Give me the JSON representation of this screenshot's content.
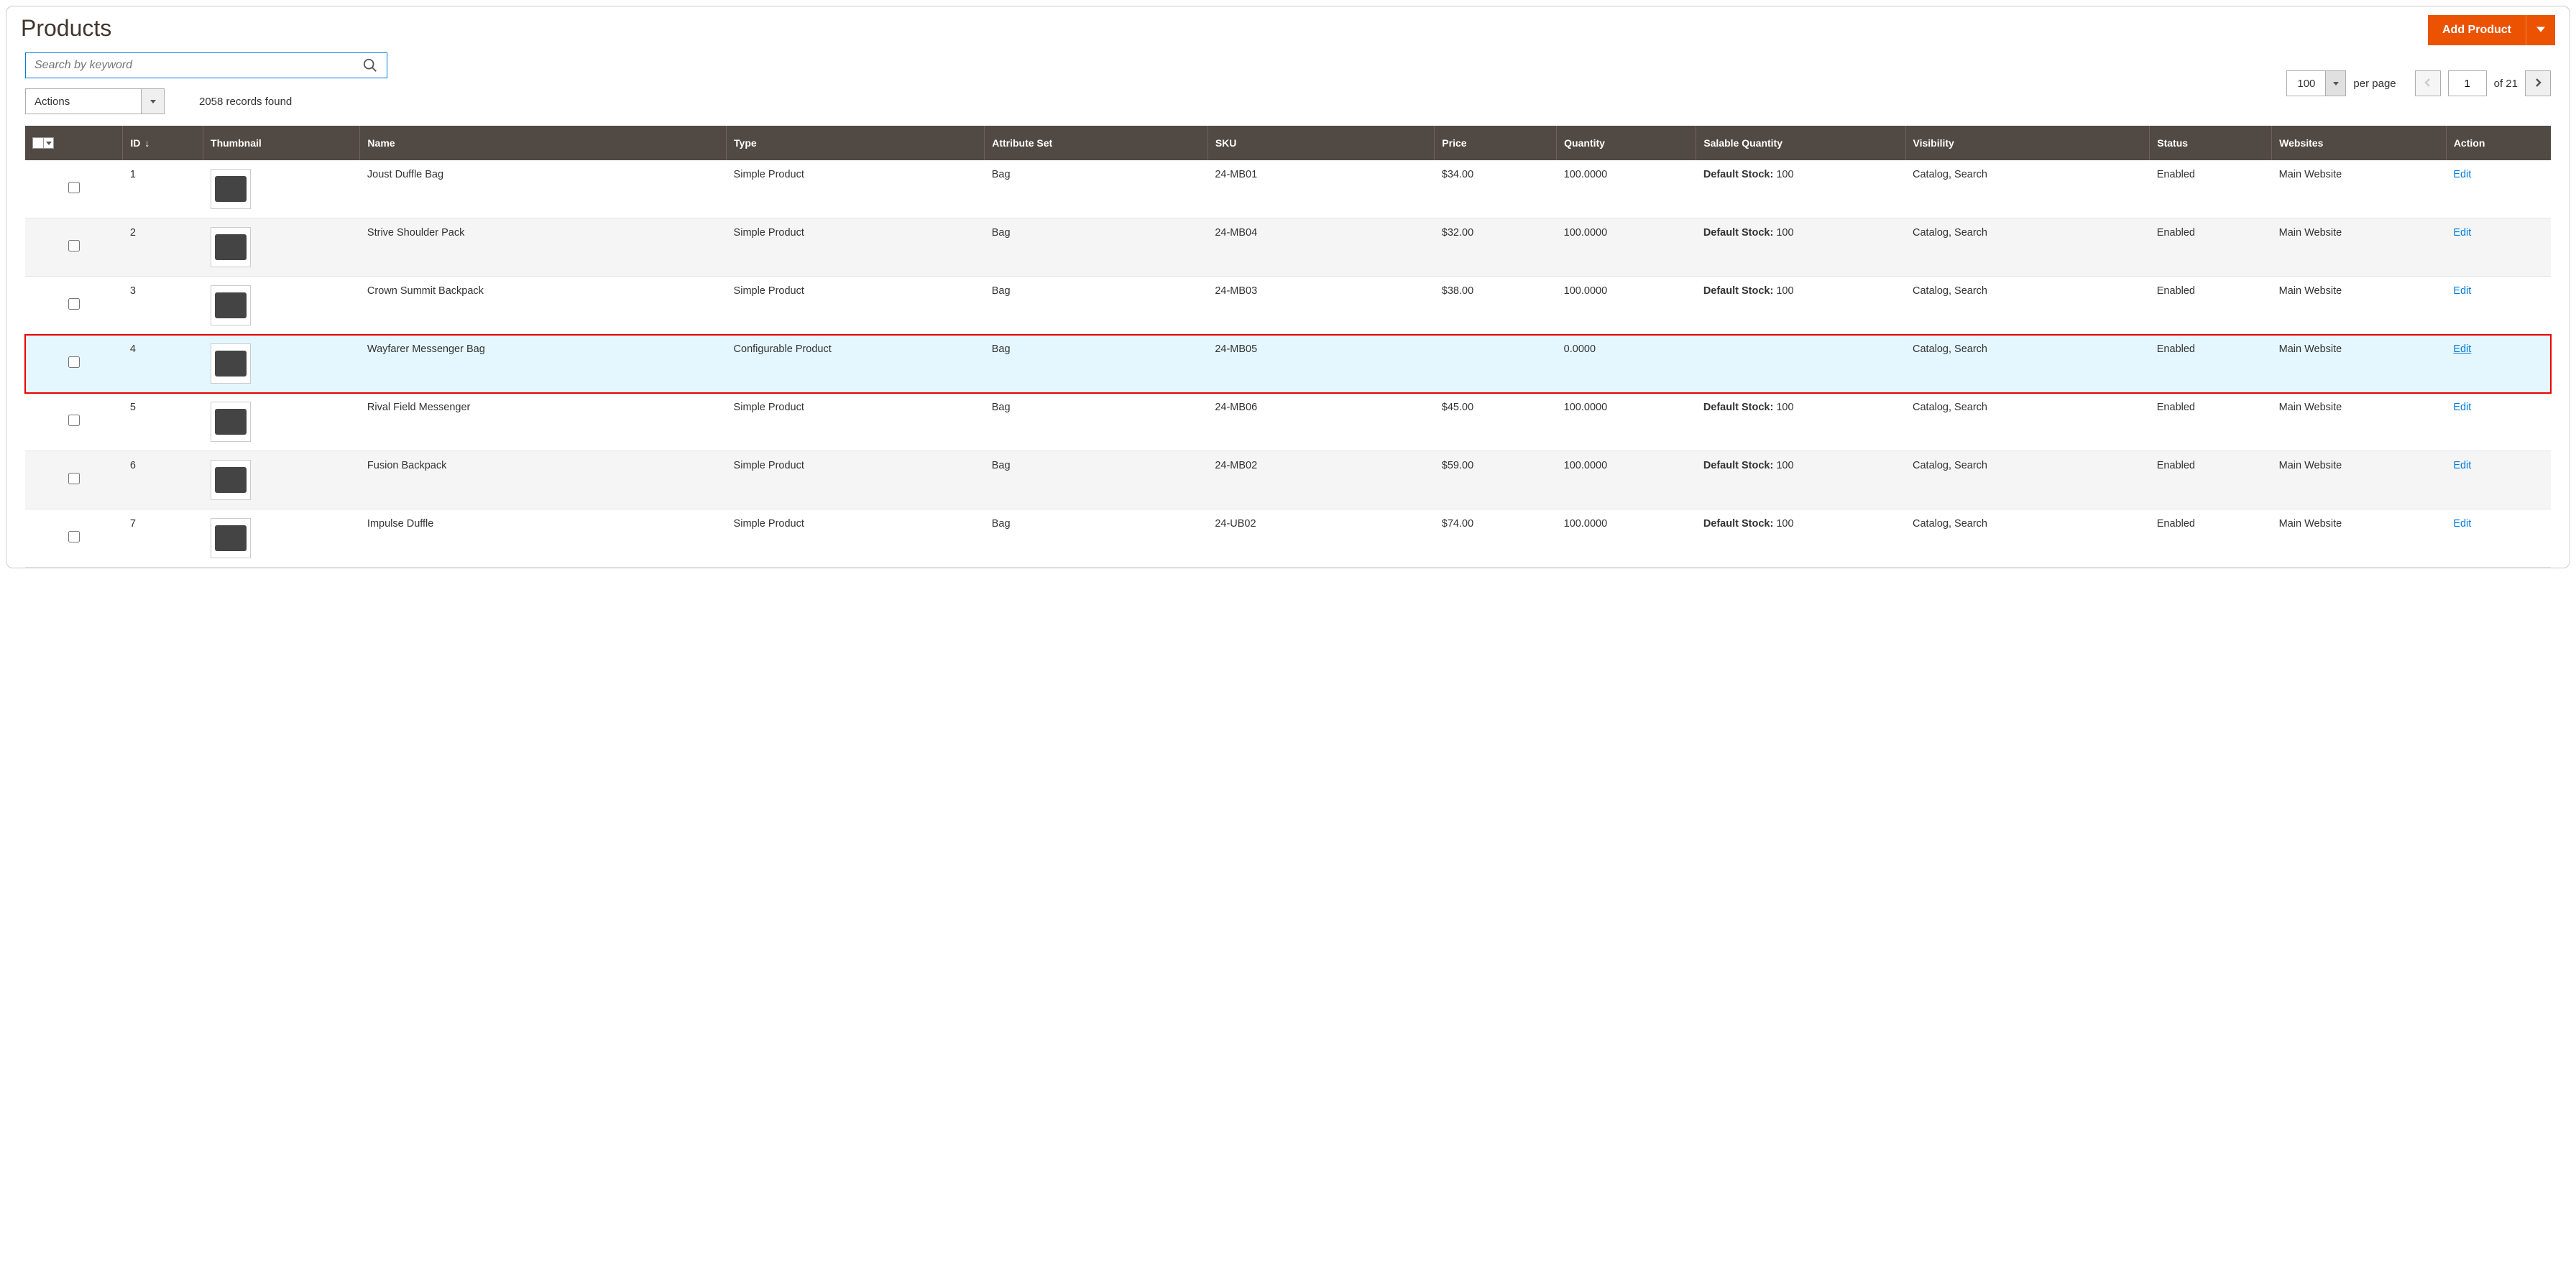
{
  "header": {
    "title": "Products",
    "add_button": "Add Product"
  },
  "toolbar": {
    "search_placeholder": "Search by keyword",
    "actions_label": "Actions",
    "records_found": "2058 records found",
    "per_page_value": "100",
    "per_page_label": "per page",
    "current_page": "1",
    "of_label": "of 21"
  },
  "grid": {
    "columns": {
      "id": "ID",
      "thumbnail": "Thumbnail",
      "name": "Name",
      "type": "Type",
      "attribute_set": "Attribute Set",
      "sku": "SKU",
      "price": "Price",
      "quantity": "Quantity",
      "salable_quantity": "Salable Quantity",
      "visibility": "Visibility",
      "status": "Status",
      "websites": "Websites",
      "action": "Action"
    },
    "rows": [
      {
        "id": "1",
        "name": "Joust Duffle Bag",
        "type": "Simple Product",
        "attr": "Bag",
        "sku": "24-MB01",
        "price": "$34.00",
        "qty": "100.0000",
        "salable_label": "Default Stock",
        "salable_value": "100",
        "visibility": "Catalog, Search",
        "status": "Enabled",
        "websites": "Main Website",
        "action": "Edit",
        "highlight": false
      },
      {
        "id": "2",
        "name": "Strive Shoulder Pack",
        "type": "Simple Product",
        "attr": "Bag",
        "sku": "24-MB04",
        "price": "$32.00",
        "qty": "100.0000",
        "salable_label": "Default Stock",
        "salable_value": "100",
        "visibility": "Catalog, Search",
        "status": "Enabled",
        "websites": "Main Website",
        "action": "Edit",
        "highlight": false
      },
      {
        "id": "3",
        "name": "Crown Summit Backpack",
        "type": "Simple Product",
        "attr": "Bag",
        "sku": "24-MB03",
        "price": "$38.00",
        "qty": "100.0000",
        "salable_label": "Default Stock",
        "salable_value": "100",
        "visibility": "Catalog, Search",
        "status": "Enabled",
        "websites": "Main Website",
        "action": "Edit",
        "highlight": false
      },
      {
        "id": "4",
        "name": "Wayfarer Messenger Bag",
        "type": "Configurable Product",
        "attr": "Bag",
        "sku": "24-MB05",
        "price": "",
        "qty": "0.0000",
        "salable_label": "",
        "salable_value": "",
        "visibility": "Catalog, Search",
        "status": "Enabled",
        "websites": "Main Website",
        "action": "Edit",
        "highlight": true
      },
      {
        "id": "5",
        "name": "Rival Field Messenger",
        "type": "Simple Product",
        "attr": "Bag",
        "sku": "24-MB06",
        "price": "$45.00",
        "qty": "100.0000",
        "salable_label": "Default Stock",
        "salable_value": "100",
        "visibility": "Catalog, Search",
        "status": "Enabled",
        "websites": "Main Website",
        "action": "Edit",
        "highlight": false
      },
      {
        "id": "6",
        "name": "Fusion Backpack",
        "type": "Simple Product",
        "attr": "Bag",
        "sku": "24-MB02",
        "price": "$59.00",
        "qty": "100.0000",
        "salable_label": "Default Stock",
        "salable_value": "100",
        "visibility": "Catalog, Search",
        "status": "Enabled",
        "websites": "Main Website",
        "action": "Edit",
        "highlight": false
      },
      {
        "id": "7",
        "name": "Impulse Duffle",
        "type": "Simple Product",
        "attr": "Bag",
        "sku": "24-UB02",
        "price": "$74.00",
        "qty": "100.0000",
        "salable_label": "Default Stock",
        "salable_value": "100",
        "visibility": "Catalog, Search",
        "status": "Enabled",
        "websites": "Main Website",
        "action": "Edit",
        "highlight": false
      }
    ]
  }
}
